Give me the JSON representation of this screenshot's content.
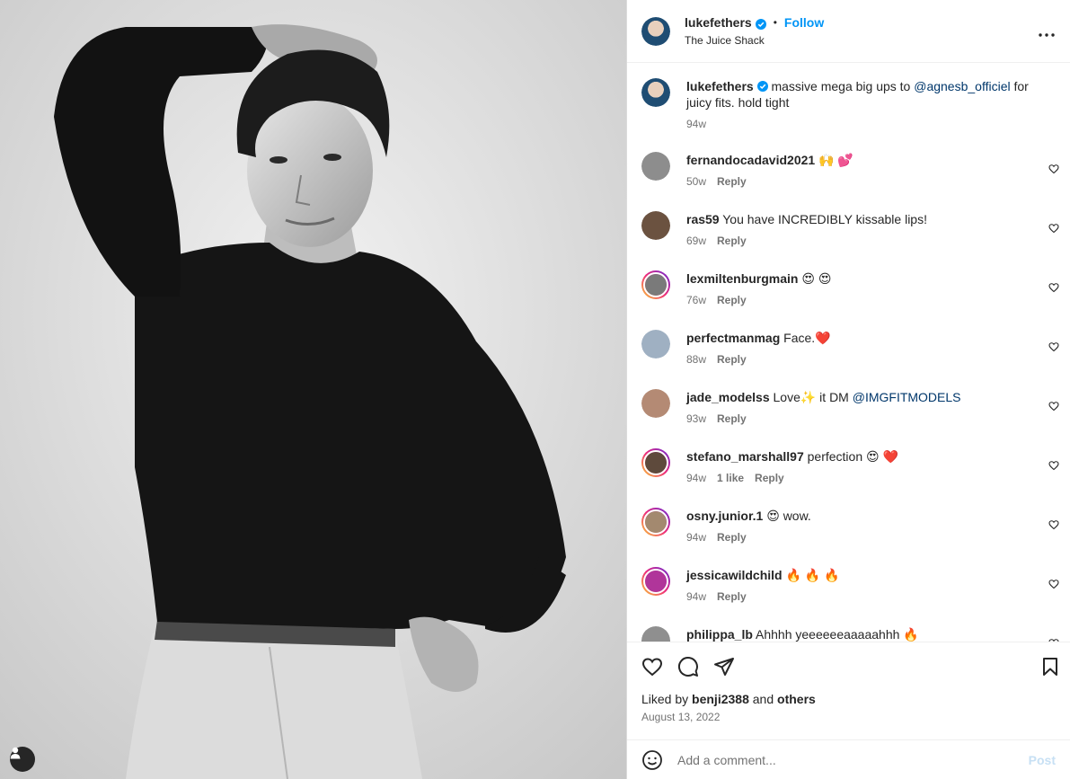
{
  "post": {
    "author": "lukefethers",
    "follow_label": "Follow",
    "location": "The Juice Shack",
    "caption_text": "massive mega big ups to",
    "caption_mention": "@agnesb_officiel",
    "caption_tail": "for juicy fits. hold tight",
    "caption_time": "94w",
    "liked_by_prefix": "Liked by",
    "liked_by_user": "benji2388",
    "liked_by_and": "and",
    "liked_by_others": "others",
    "date": "August 13, 2022",
    "add_comment_placeholder": "Add a comment...",
    "post_label": "Post"
  },
  "comments": [
    {
      "user": "fernandocadavid2021",
      "text": "🙌 💕",
      "mention": "",
      "time": "50w",
      "likes": "",
      "reply": "Reply",
      "avatar_color": "#8d8d8d",
      "ring": false
    },
    {
      "user": "ras59",
      "text": "You have INCREDIBLY kissable lips!",
      "mention": "",
      "time": "69w",
      "likes": "",
      "reply": "Reply",
      "avatar_color": "#6b5240",
      "ring": false
    },
    {
      "user": "lexmiltenburgmain",
      "text": "😍 😍",
      "mention": "",
      "time": "76w",
      "likes": "",
      "reply": "Reply",
      "avatar_color": "#7a7a7a",
      "ring": true
    },
    {
      "user": "perfectmanmag",
      "text": "Face.❤️",
      "mention": "",
      "time": "88w",
      "likes": "",
      "reply": "Reply",
      "avatar_color": "#9fb0c2",
      "ring": false
    },
    {
      "user": "jade_modelss",
      "text": "Love✨ it DM",
      "mention": "@IMGFITMODELS",
      "time": "93w",
      "likes": "",
      "reply": "Reply",
      "avatar_color": "#b48a74",
      "ring": false
    },
    {
      "user": "stefano_marshall97",
      "text": "perfection 😍 ❤️",
      "mention": "",
      "time": "94w",
      "likes": "1 like",
      "reply": "Reply",
      "avatar_color": "#5e4a3c",
      "ring": true
    },
    {
      "user": "osny.junior.1",
      "text": "😍 wow.",
      "mention": "",
      "time": "94w",
      "likes": "",
      "reply": "Reply",
      "avatar_color": "#a3896f",
      "ring": true
    },
    {
      "user": "jessicawildchild",
      "text": "🔥 🔥 🔥",
      "mention": "",
      "time": "94w",
      "likes": "",
      "reply": "Reply",
      "avatar_color": "#b0359a",
      "ring": true
    },
    {
      "user": "philippa_lb",
      "text": "Ahhhh yeeeeeeaaaaahhh 🔥",
      "mention": "",
      "time": "",
      "likes": "",
      "reply": "",
      "avatar_color": "#8f8f8f",
      "ring": false
    }
  ],
  "colors": {
    "accent": "#0095f6",
    "text": "#262626",
    "secondary": "#737373",
    "verified": "#0095f6"
  },
  "icons": {
    "like": "heart-icon",
    "comment": "comment-icon",
    "share": "paper-plane-icon",
    "save": "bookmark-icon",
    "more": "more-horizontal-icon",
    "emoji": "smiley-icon",
    "user_tag": "user-icon"
  }
}
